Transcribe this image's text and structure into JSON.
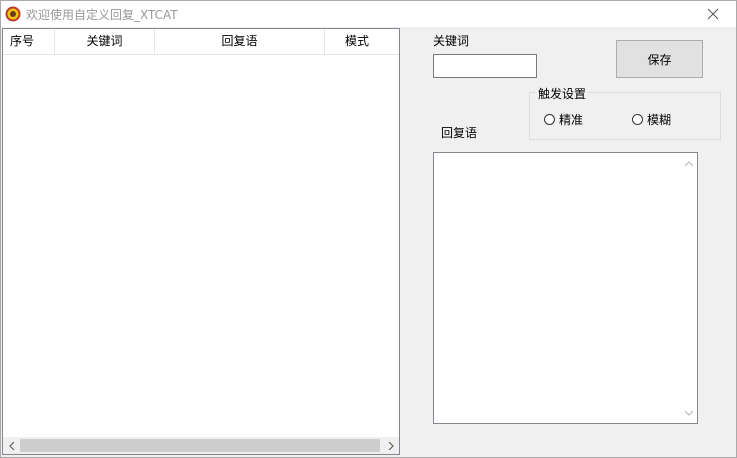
{
  "window": {
    "title": "欢迎使用自定义回复_XTCAT",
    "app_icon": "xtcat-app-icon",
    "close_icon": "close-icon"
  },
  "list": {
    "columns": [
      "序号",
      "关键词",
      "回复语",
      "模式"
    ],
    "rows": []
  },
  "form": {
    "keyword_label": "关键词",
    "keyword_value": "",
    "save_label": "保存",
    "trigger_group_label": "触发设置",
    "radio_exact_label": "精准",
    "radio_fuzzy_label": "模糊",
    "reply_label": "回复语",
    "reply_value": ""
  }
}
